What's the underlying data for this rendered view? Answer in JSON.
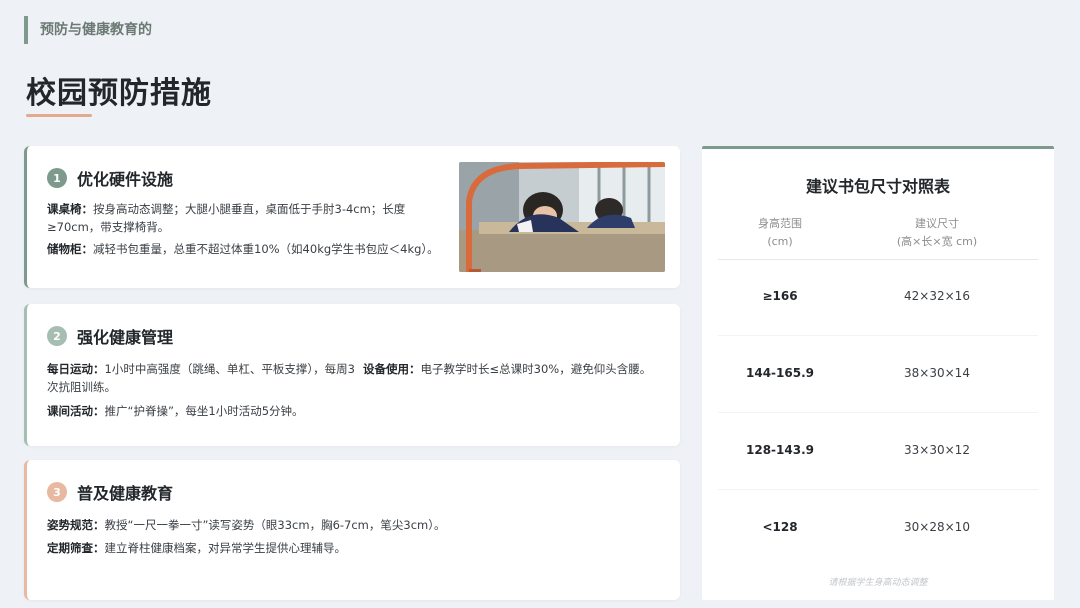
{
  "breadcrumb": "预防与健康教育的",
  "page_title": "校园预防措施",
  "cards": [
    {
      "number": "1",
      "title": "优化硬件设施",
      "items": [
        {
          "label": "课桌椅：",
          "text": "按身高动态调整；大腿小腿垂直，桌面低于手肘3-4cm；长度≥70cm，带支撑椅背。"
        },
        {
          "label": "储物柜：",
          "text": "减轻书包重量，总重不超过体重10%（如40kg学生书包应＜4kg）。"
        }
      ]
    },
    {
      "number": "2",
      "title": "强化健康管理",
      "items": [
        {
          "label": "每日运动：",
          "text": "1小时中高强度（跳绳、单杠、平板支撑），每周3次抗阻训练。"
        },
        {
          "label": "设备使用：",
          "text": "电子教学时长≤总课时30%，避免仰头含腰。"
        },
        {
          "label": "课间活动：",
          "text": "推广“护脊操”，每坐1小时活动5分钟。"
        }
      ]
    },
    {
      "number": "3",
      "title": "普及健康教育",
      "items": [
        {
          "label": "姿势规范：",
          "text": "教授“一尺一拳一寸”读写姿势（眼33cm，胸6-7cm，笔尖3cm）。"
        },
        {
          "label": "定期筛查：",
          "text": "建立脊柱健康档案，对异常学生提供心理辅导。"
        }
      ]
    }
  ],
  "table": {
    "title": "建议书包尺寸对照表",
    "col1_header_line1": "身高范围",
    "col1_header_line2": "(cm)",
    "col2_header_line1": "建议尺寸",
    "col2_header_line2": "(高×长×宽 cm)",
    "rows": [
      {
        "height": "≥166",
        "size": "42×32×16"
      },
      {
        "height": "144-165.9",
        "size": "38×30×14"
      },
      {
        "height": "128-143.9",
        "size": "33×30×12"
      },
      {
        "height": "<128",
        "size": "30×28×10"
      }
    ],
    "footnote": "请根据学生身高动态调整"
  }
}
